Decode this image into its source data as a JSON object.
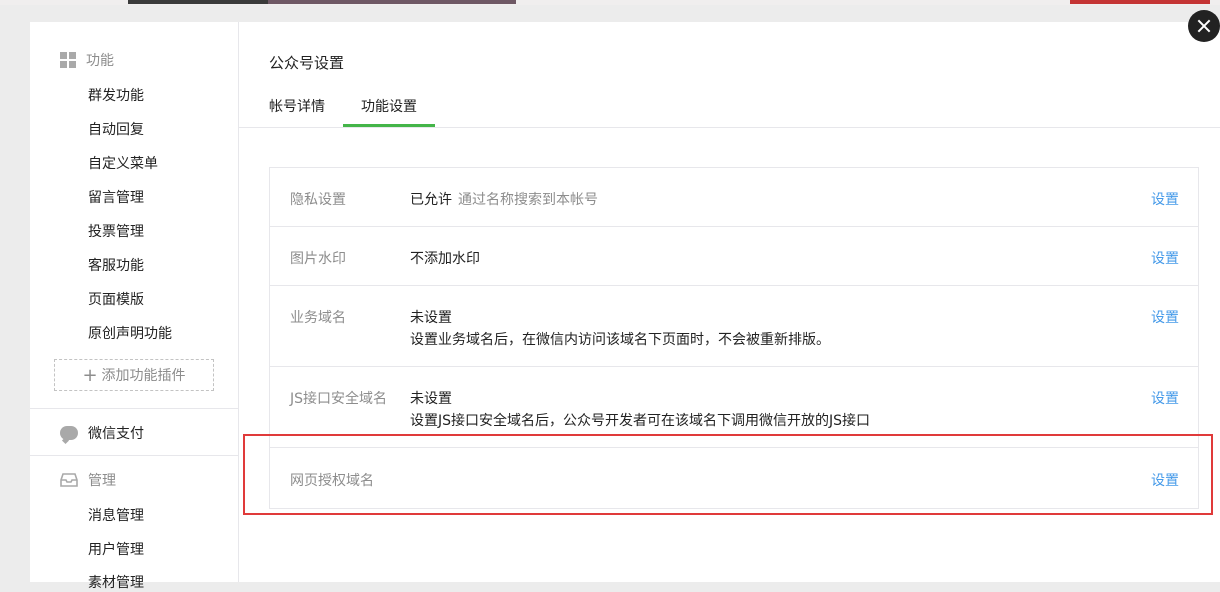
{
  "sidebar": {
    "features": {
      "header": "功能",
      "items": [
        "群发功能",
        "自动回复",
        "自定义菜单",
        "留言管理",
        "投票管理",
        "客服功能",
        "页面模版",
        "原创声明功能"
      ],
      "add_plugin": "添加功能插件"
    },
    "wechat_pay": "微信支付",
    "manage": {
      "header": "管理",
      "items": [
        "消息管理",
        "用户管理",
        "素材管理"
      ]
    }
  },
  "main": {
    "title": "公众号设置",
    "tabs": [
      {
        "label": "帐号详情",
        "active": false
      },
      {
        "label": "功能设置",
        "active": true
      }
    ],
    "rows": [
      {
        "name": "隐私设置",
        "value": "已允许",
        "hint": "通过名称搜索到本帐号",
        "action": "设置"
      },
      {
        "name": "图片水印",
        "value": "不添加水印",
        "action": "设置"
      },
      {
        "name": "业务域名",
        "value": "未设置",
        "desc": "设置业务域名后，在微信内访问该域名下页面时，不会被重新排版。",
        "action": "设置"
      },
      {
        "name": "JS接口安全域名",
        "value": "未设置",
        "desc": "设置JS接口安全域名后，公众号开发者可在该域名下调用微信开放的JS接口",
        "action": "设置"
      },
      {
        "name": "网页授权域名",
        "action": "设置"
      }
    ]
  },
  "colors": {
    "accent_green": "#44b549",
    "link_blue": "#459ae9",
    "highlight_red": "#e03a3a"
  },
  "icons": {
    "features": "grid-icon",
    "pay": "chat-bubble-icon",
    "manage": "inbox-tray-icon",
    "close": "close-icon"
  }
}
